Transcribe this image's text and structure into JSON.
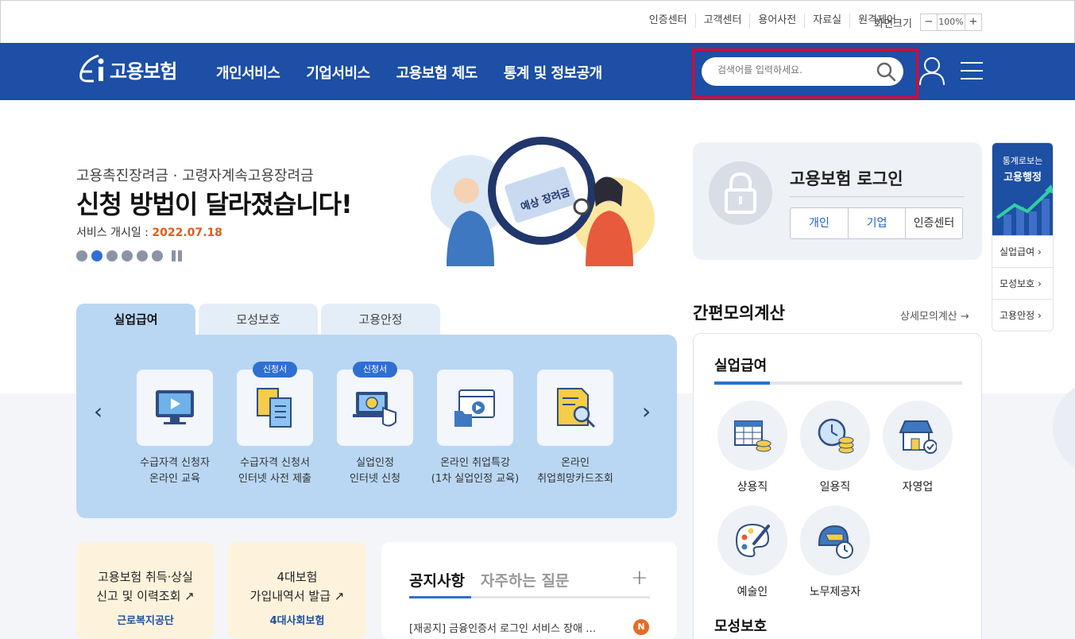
{
  "util": {
    "links": [
      "인증센터",
      "고객센터",
      "용어사전",
      "자료실",
      "원격제어"
    ],
    "zoom_label": "화면크기",
    "zoom_minus": "−",
    "zoom_value": "100%",
    "zoom_plus": "+"
  },
  "header": {
    "logo_text": "고용보험",
    "menu": [
      "개인서비스",
      "기업서비스",
      "고용보험 제도",
      "통계 및 정보공개"
    ],
    "search_placeholder": "검색어를 입력하세요."
  },
  "hero": {
    "subtitle": "고용촉진장려금 · 고령자계속고용장려금",
    "title": "신청 방법이 달라졌습니다!",
    "date_label": "서비스 개시일 : ",
    "date_value": "2022.07.18",
    "art_text": "예상 장려금"
  },
  "login": {
    "title": "고용보험 로그인",
    "buttons": [
      "개인",
      "기업",
      "인증센터"
    ]
  },
  "side": {
    "top_line1": "통계로보는",
    "top_line2": "고용행정",
    "items": [
      "실업급여 ›",
      "모성보호 ›",
      "고용안정 ›"
    ]
  },
  "tabs": [
    "실업급여",
    "모성보호",
    "고용안정"
  ],
  "services": [
    {
      "label": "수급자격 신청자\n온라인 교육",
      "badge": "",
      "icon": "monitor-play-icon"
    },
    {
      "label": "수급자격 신청서\n인터넷 사전 제출",
      "badge": "신청서",
      "icon": "documents-icon"
    },
    {
      "label": "실업인정\n인터넷 신청",
      "badge": "신청서",
      "icon": "laptop-coin-icon"
    },
    {
      "label": "온라인 취업특강\n(1차 실업인정 교육)",
      "badge": "",
      "icon": "video-folder-icon"
    },
    {
      "label": "온라인\n취업희망카드조회",
      "badge": "",
      "icon": "document-search-icon"
    }
  ],
  "arrows": {
    "prev": "‹",
    "next": "›"
  },
  "bottom_cards": [
    {
      "text": "고용보험 취득·상실\n신고 및 이력조회 ↗",
      "org": "근로복지공단"
    },
    {
      "text": "4대보험\n가입내역서 발급 ↗",
      "org": "4대사회보험"
    }
  ],
  "notice": {
    "tabs": [
      "공지사항",
      "자주하는 질문"
    ],
    "plus": "+",
    "item": "[재공지] 금융인증서 로그인 서비스 장애 …",
    "badge": "N"
  },
  "calc": {
    "title": "간편모의계산",
    "more": "상세모의계산 →",
    "section": "실업급여",
    "items": [
      "상용직",
      "일용직",
      "자영업",
      "예술인",
      "노무제공자"
    ],
    "section2": "모성보호"
  },
  "colors": {
    "brand": "#1c4fa5",
    "accent": "#2f6fd1",
    "highlight": "#e4002b",
    "date": "#e25a1c"
  }
}
